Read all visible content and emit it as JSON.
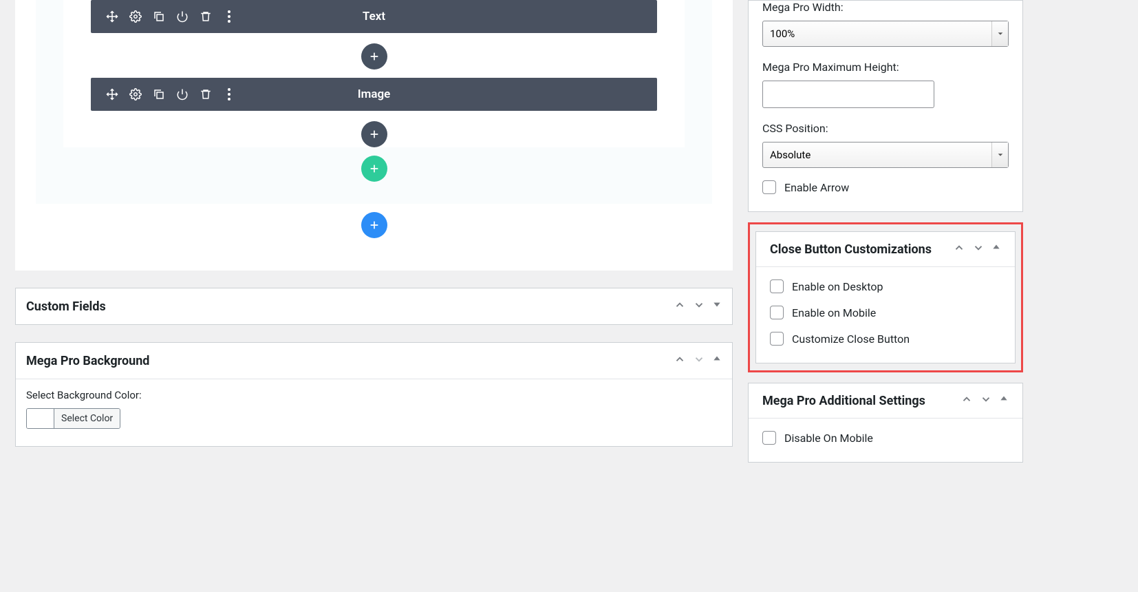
{
  "builder": {
    "modules": [
      {
        "label": "Text"
      },
      {
        "label": "Image"
      }
    ]
  },
  "panels": {
    "customFields": {
      "title": "Custom Fields"
    },
    "megaBackground": {
      "title": "Mega Pro Background",
      "bgColorLabel": "Select Background Color:",
      "colorBtn": "Select Color"
    }
  },
  "side": {
    "sizing": {
      "widthLabel": "Mega Pro Width:",
      "widthValue": "100%",
      "maxHeightLabel": "Mega Pro Maximum Height:",
      "maxHeightValue": "",
      "cssPosLabel": "CSS Position:",
      "cssPosValue": "Absolute",
      "enableArrow": "Enable Arrow"
    },
    "closeBtn": {
      "title": "Close Button Customizations",
      "opts": [
        "Enable on Desktop",
        "Enable on Mobile",
        "Customize Close Button"
      ]
    },
    "additional": {
      "title": "Mega Pro Additional Settings",
      "opts": [
        "Disable On Mobile"
      ]
    }
  }
}
